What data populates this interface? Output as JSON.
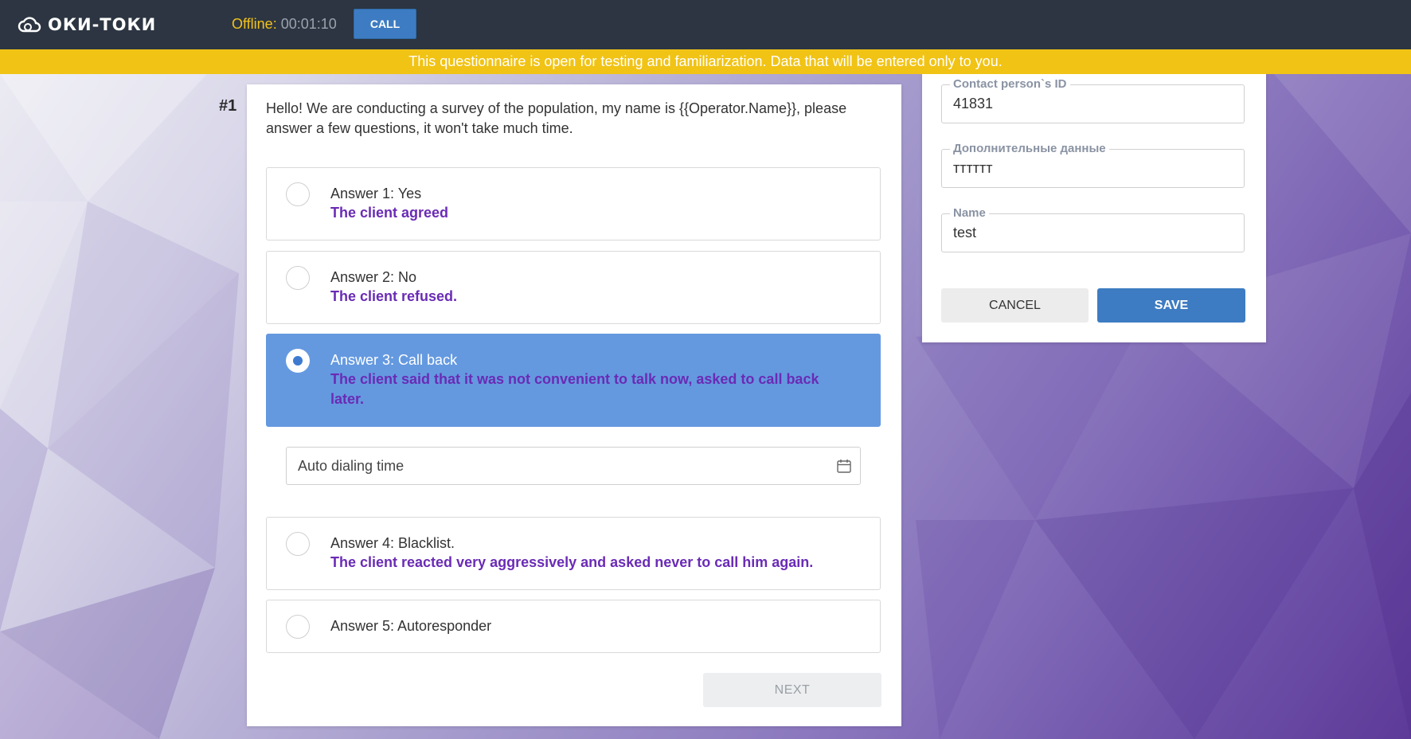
{
  "header": {
    "logo_text": "ОКИ-ТОКИ",
    "status_label": "Offline:",
    "status_time": "00:01:10",
    "call_label": "CALL"
  },
  "banner": "This questionnaire is open for testing and familiarization. Data that will be entered only to you.",
  "question": {
    "number": "#1",
    "text": "Hello! We are conducting a survey of the population, my name is {{Operator.Name}}, please answer a few questions, it won't take much time.",
    "answers": [
      {
        "title": "Answer 1: Yes",
        "subtitle": "The client agreed",
        "selected": false
      },
      {
        "title": "Answer 2: No",
        "subtitle": "The client refused.",
        "selected": false
      },
      {
        "title": "Answer 3: Call back",
        "subtitle": "The client said that it was not convenient to talk now, asked to call back later.",
        "selected": true
      },
      {
        "title": "Answer 4: Blacklist.",
        "subtitle": "The client reacted very aggressively and asked never to call him again.",
        "selected": false
      },
      {
        "title": "Answer 5: Autoresponder",
        "subtitle": "",
        "selected": false
      }
    ],
    "datetime_placeholder": "Auto dialing time",
    "next_label": "NEXT"
  },
  "contact_form": {
    "fields": [
      {
        "label": "Contact person`s ID",
        "value": "41831"
      },
      {
        "label": "Дополнительные данные",
        "value": "тттттт"
      },
      {
        "label": "Name",
        "value": "test"
      }
    ],
    "cancel_label": "CANCEL",
    "save_label": "SAVE"
  },
  "colors": {
    "topbar": "#2c3541",
    "banner": "#f1c315",
    "accent": "#3d7cc2",
    "selected_answer": "#6499e0",
    "subtitle": "#6a2bb5"
  }
}
